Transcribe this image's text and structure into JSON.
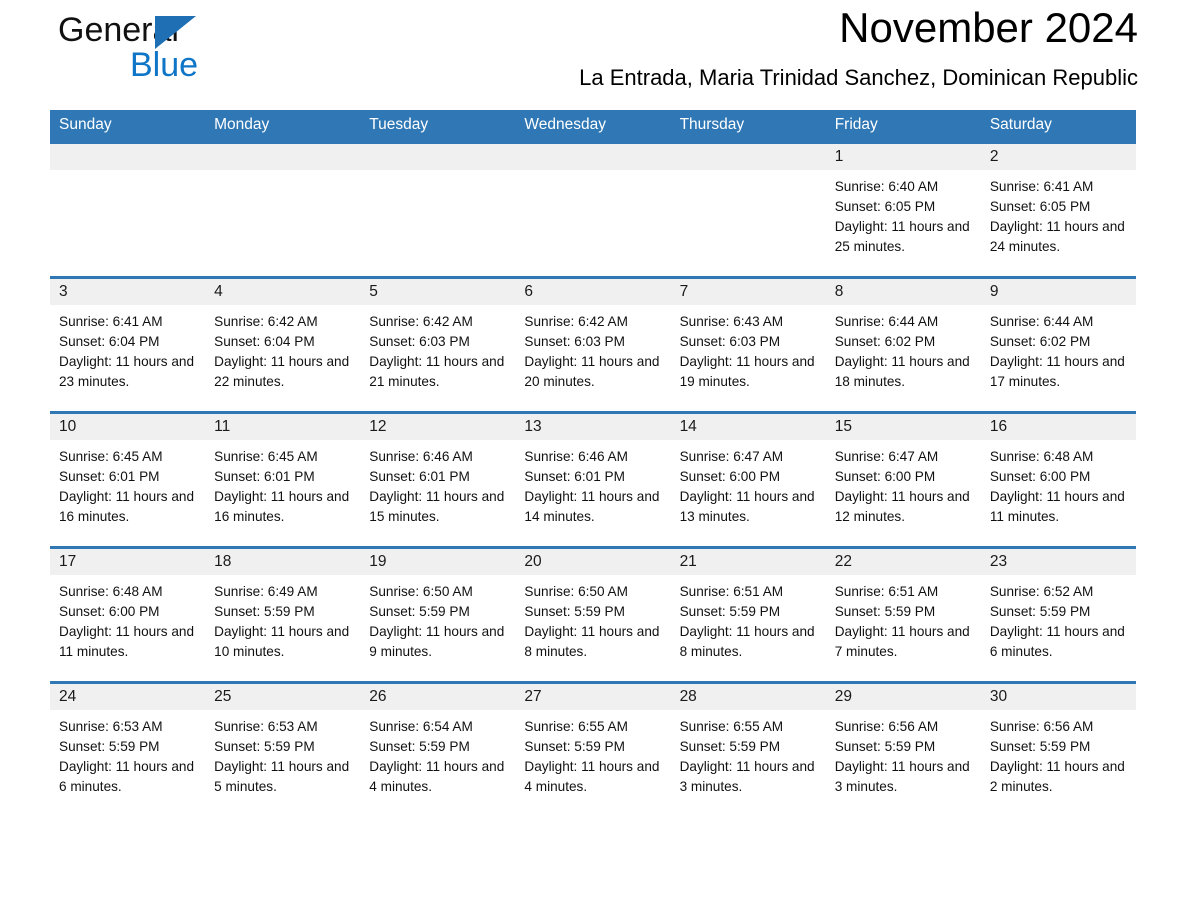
{
  "brand": {
    "name_part1": "General",
    "name_part2": "Blue",
    "triangle_color": "#1f6fb4",
    "blue_text_color": "#0f76c7"
  },
  "header": {
    "month_title": "November 2024",
    "location": "La Entrada, Maria Trinidad Sanchez, Dominican Republic"
  },
  "theme": {
    "header_row_bg": "#2f77b5",
    "daynum_bg": "#f0f0f0",
    "row_divider": "#2f77b5",
    "text": "#111111"
  },
  "daynames": [
    "Sunday",
    "Monday",
    "Tuesday",
    "Wednesday",
    "Thursday",
    "Friday",
    "Saturday"
  ],
  "labels": {
    "sunrise_prefix": "Sunrise:",
    "sunset_prefix": "Sunset:",
    "daylight_prefix": "Daylight:"
  },
  "weeks": [
    [
      {
        "day": "",
        "empty": true
      },
      {
        "day": "",
        "empty": true
      },
      {
        "day": "",
        "empty": true
      },
      {
        "day": "",
        "empty": true
      },
      {
        "day": "",
        "empty": true
      },
      {
        "day": "1",
        "sunrise": "Sunrise: 6:40 AM",
        "sunset": "Sunset: 6:05 PM",
        "daylight": "Daylight: 11 hours and 25 minutes."
      },
      {
        "day": "2",
        "sunrise": "Sunrise: 6:41 AM",
        "sunset": "Sunset: 6:05 PM",
        "daylight": "Daylight: 11 hours and 24 minutes."
      }
    ],
    [
      {
        "day": "3",
        "sunrise": "Sunrise: 6:41 AM",
        "sunset": "Sunset: 6:04 PM",
        "daylight": "Daylight: 11 hours and 23 minutes."
      },
      {
        "day": "4",
        "sunrise": "Sunrise: 6:42 AM",
        "sunset": "Sunset: 6:04 PM",
        "daylight": "Daylight: 11 hours and 22 minutes."
      },
      {
        "day": "5",
        "sunrise": "Sunrise: 6:42 AM",
        "sunset": "Sunset: 6:03 PM",
        "daylight": "Daylight: 11 hours and 21 minutes."
      },
      {
        "day": "6",
        "sunrise": "Sunrise: 6:42 AM",
        "sunset": "Sunset: 6:03 PM",
        "daylight": "Daylight: 11 hours and 20 minutes."
      },
      {
        "day": "7",
        "sunrise": "Sunrise: 6:43 AM",
        "sunset": "Sunset: 6:03 PM",
        "daylight": "Daylight: 11 hours and 19 minutes."
      },
      {
        "day": "8",
        "sunrise": "Sunrise: 6:44 AM",
        "sunset": "Sunset: 6:02 PM",
        "daylight": "Daylight: 11 hours and 18 minutes."
      },
      {
        "day": "9",
        "sunrise": "Sunrise: 6:44 AM",
        "sunset": "Sunset: 6:02 PM",
        "daylight": "Daylight: 11 hours and 17 minutes."
      }
    ],
    [
      {
        "day": "10",
        "sunrise": "Sunrise: 6:45 AM",
        "sunset": "Sunset: 6:01 PM",
        "daylight": "Daylight: 11 hours and 16 minutes."
      },
      {
        "day": "11",
        "sunrise": "Sunrise: 6:45 AM",
        "sunset": "Sunset: 6:01 PM",
        "daylight": "Daylight: 11 hours and 16 minutes."
      },
      {
        "day": "12",
        "sunrise": "Sunrise: 6:46 AM",
        "sunset": "Sunset: 6:01 PM",
        "daylight": "Daylight: 11 hours and 15 minutes."
      },
      {
        "day": "13",
        "sunrise": "Sunrise: 6:46 AM",
        "sunset": "Sunset: 6:01 PM",
        "daylight": "Daylight: 11 hours and 14 minutes."
      },
      {
        "day": "14",
        "sunrise": "Sunrise: 6:47 AM",
        "sunset": "Sunset: 6:00 PM",
        "daylight": "Daylight: 11 hours and 13 minutes."
      },
      {
        "day": "15",
        "sunrise": "Sunrise: 6:47 AM",
        "sunset": "Sunset: 6:00 PM",
        "daylight": "Daylight: 11 hours and 12 minutes."
      },
      {
        "day": "16",
        "sunrise": "Sunrise: 6:48 AM",
        "sunset": "Sunset: 6:00 PM",
        "daylight": "Daylight: 11 hours and 11 minutes."
      }
    ],
    [
      {
        "day": "17",
        "sunrise": "Sunrise: 6:48 AM",
        "sunset": "Sunset: 6:00 PM",
        "daylight": "Daylight: 11 hours and 11 minutes."
      },
      {
        "day": "18",
        "sunrise": "Sunrise: 6:49 AM",
        "sunset": "Sunset: 5:59 PM",
        "daylight": "Daylight: 11 hours and 10 minutes."
      },
      {
        "day": "19",
        "sunrise": "Sunrise: 6:50 AM",
        "sunset": "Sunset: 5:59 PM",
        "daylight": "Daylight: 11 hours and 9 minutes."
      },
      {
        "day": "20",
        "sunrise": "Sunrise: 6:50 AM",
        "sunset": "Sunset: 5:59 PM",
        "daylight": "Daylight: 11 hours and 8 minutes."
      },
      {
        "day": "21",
        "sunrise": "Sunrise: 6:51 AM",
        "sunset": "Sunset: 5:59 PM",
        "daylight": "Daylight: 11 hours and 8 minutes."
      },
      {
        "day": "22",
        "sunrise": "Sunrise: 6:51 AM",
        "sunset": "Sunset: 5:59 PM",
        "daylight": "Daylight: 11 hours and 7 minutes."
      },
      {
        "day": "23",
        "sunrise": "Sunrise: 6:52 AM",
        "sunset": "Sunset: 5:59 PM",
        "daylight": "Daylight: 11 hours and 6 minutes."
      }
    ],
    [
      {
        "day": "24",
        "sunrise": "Sunrise: 6:53 AM",
        "sunset": "Sunset: 5:59 PM",
        "daylight": "Daylight: 11 hours and 6 minutes."
      },
      {
        "day": "25",
        "sunrise": "Sunrise: 6:53 AM",
        "sunset": "Sunset: 5:59 PM",
        "daylight": "Daylight: 11 hours and 5 minutes."
      },
      {
        "day": "26",
        "sunrise": "Sunrise: 6:54 AM",
        "sunset": "Sunset: 5:59 PM",
        "daylight": "Daylight: 11 hours and 4 minutes."
      },
      {
        "day": "27",
        "sunrise": "Sunrise: 6:55 AM",
        "sunset": "Sunset: 5:59 PM",
        "daylight": "Daylight: 11 hours and 4 minutes."
      },
      {
        "day": "28",
        "sunrise": "Sunrise: 6:55 AM",
        "sunset": "Sunset: 5:59 PM",
        "daylight": "Daylight: 11 hours and 3 minutes."
      },
      {
        "day": "29",
        "sunrise": "Sunrise: 6:56 AM",
        "sunset": "Sunset: 5:59 PM",
        "daylight": "Daylight: 11 hours and 3 minutes."
      },
      {
        "day": "30",
        "sunrise": "Sunrise: 6:56 AM",
        "sunset": "Sunset: 5:59 PM",
        "daylight": "Daylight: 11 hours and 2 minutes."
      }
    ]
  ]
}
